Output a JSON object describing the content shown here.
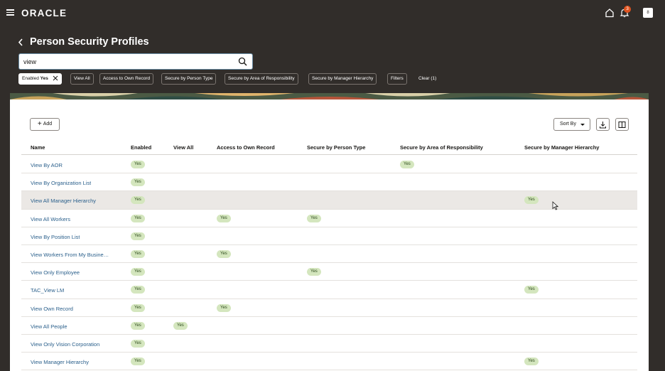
{
  "header": {
    "logo": "ORACLE",
    "notification_count": "3",
    "avatar_initial": "8"
  },
  "page": {
    "title": "Person Security Profiles"
  },
  "search": {
    "value": "view"
  },
  "filters": {
    "selected_chip": {
      "label": "Enabled",
      "value": "Yes"
    },
    "chips": [
      "View All",
      "Access to Own Record",
      "Secure by Person Type",
      "Secure by Area of Responsibility",
      "Secure by Manager Hierarchy",
      "Filters"
    ],
    "clear_label": "Clear (1)"
  },
  "toolbar": {
    "add_label": "Add",
    "sort_label": "Sort By"
  },
  "table": {
    "columns": [
      "Name",
      "Enabled",
      "View All",
      "Access to Own Record",
      "Secure by Person Type",
      "Secure by Area of Responsibility",
      "Secure by Manager Hierarchy"
    ],
    "rows": [
      {
        "name": "View By AOR",
        "enabled": "Yes",
        "view_all": "",
        "own_record": "",
        "person_type": "",
        "aor": "Yes",
        "manager": ""
      },
      {
        "name": "View By Organization List",
        "enabled": "Yes",
        "view_all": "",
        "own_record": "",
        "person_type": "",
        "aor": "",
        "manager": ""
      },
      {
        "name": "View All Manager Hierarchy",
        "enabled": "Yes",
        "view_all": "",
        "own_record": "",
        "person_type": "",
        "aor": "",
        "manager": "Yes"
      },
      {
        "name": "View All Workers",
        "enabled": "Yes",
        "view_all": "",
        "own_record": "Yes",
        "person_type": "Yes",
        "aor": "",
        "manager": ""
      },
      {
        "name": "View By Position List",
        "enabled": "Yes",
        "view_all": "",
        "own_record": "",
        "person_type": "",
        "aor": "",
        "manager": ""
      },
      {
        "name": "View Workers From My Busine…",
        "enabled": "Yes",
        "view_all": "",
        "own_record": "Yes",
        "person_type": "",
        "aor": "",
        "manager": ""
      },
      {
        "name": "View Only Employee",
        "enabled": "Yes",
        "view_all": "",
        "own_record": "",
        "person_type": "Yes",
        "aor": "",
        "manager": ""
      },
      {
        "name": "TAC_View LM",
        "enabled": "Yes",
        "view_all": "",
        "own_record": "",
        "person_type": "",
        "aor": "",
        "manager": "Yes"
      },
      {
        "name": "View Own Record",
        "enabled": "Yes",
        "view_all": "",
        "own_record": "Yes",
        "person_type": "",
        "aor": "",
        "manager": ""
      },
      {
        "name": "View All People",
        "enabled": "Yes",
        "view_all": "Yes",
        "own_record": "",
        "person_type": "",
        "aor": "",
        "manager": ""
      },
      {
        "name": "View Only Vision Corporation",
        "enabled": "Yes",
        "view_all": "",
        "own_record": "",
        "person_type": "",
        "aor": "",
        "manager": ""
      },
      {
        "name": "View Manager Hierarchy",
        "enabled": "Yes",
        "view_all": "",
        "own_record": "",
        "person_type": "",
        "aor": "",
        "manager": "Yes"
      }
    ]
  },
  "colors": {
    "header_bg": "#312d2a",
    "link": "#2a5f8b",
    "pill_bg": "#d4e6be",
    "row_highlight": "#ebe8e5"
  }
}
